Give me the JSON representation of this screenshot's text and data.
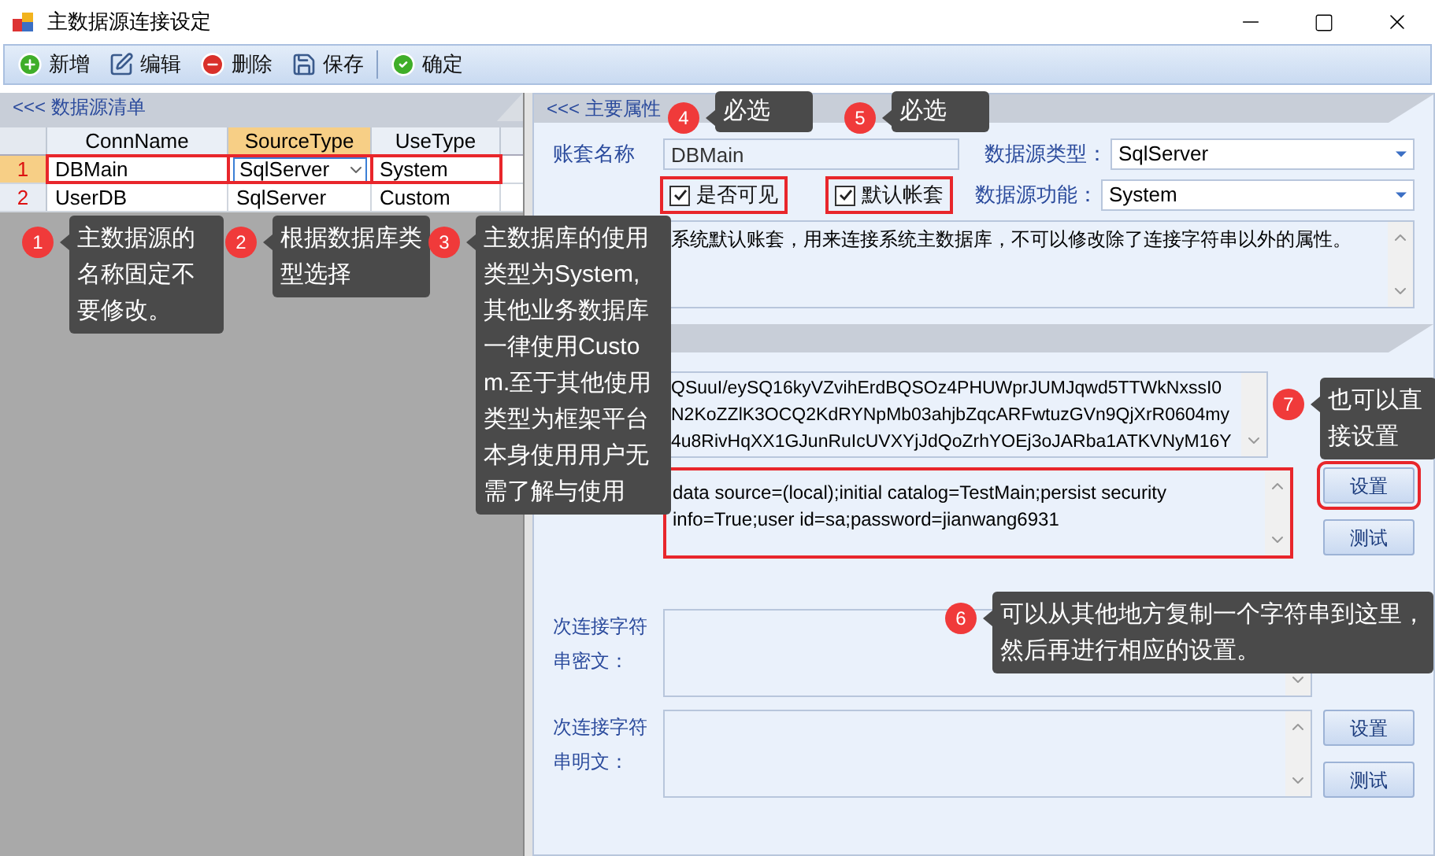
{
  "window": {
    "title": "主数据源连接设定"
  },
  "toolbar": [
    {
      "label": "新增",
      "kind": "add"
    },
    {
      "label": "编辑",
      "kind": "edit"
    },
    {
      "label": "删除",
      "kind": "delete"
    },
    {
      "label": "保存",
      "kind": "save"
    },
    {
      "label": "确定",
      "kind": "confirm"
    }
  ],
  "data_source_list": {
    "title": "<<< 数据源清单",
    "columns": [
      {
        "label": "ConnName",
        "selected": false
      },
      {
        "label": "SourceType",
        "selected": true
      },
      {
        "label": "UseType",
        "selected": false
      }
    ],
    "rows": [
      {
        "number": "1",
        "cells": [
          "DBMain",
          "SqlServer",
          "System"
        ],
        "selected": true
      },
      {
        "number": "2",
        "cells": [
          "UserDB",
          "SqlServer",
          "Custom"
        ],
        "selected": false
      }
    ]
  },
  "main_properties": {
    "title": "<<< 主要属性",
    "account_name": {
      "label": "账套名称",
      "value": "DBMain"
    },
    "visible": {
      "label": "是否可见",
      "checked": true
    },
    "default_account": {
      "label": "默认帐套",
      "checked": true
    },
    "source_type": {
      "label": "数据源类型：",
      "value": "SqlServer"
    },
    "source_function": {
      "label": "数据源功能：",
      "value": "System"
    },
    "remark": {
      "value": "系统默认账套，用来连接系统主数据库，不可以修改除了连接字符串以外的属性。"
    }
  },
  "connection": {
    "primary_cipher": {
      "lines": [
        "QSuuI/eySQ16kyVZvihErdBQSOz4PHUWprJUMJqwd5TTWkNxssI0",
        "N2KoZZlK3OCQ2KdRYNpMb03ahjbZqcARFwtuzGVn9QjXrR0604my",
        "4u8RivHqXX1GJunRuIcUVXYjJdQoZrhYOEj3oJARba1ATKVNyM16Y"
      ]
    },
    "primary_plain": {
      "lines": [
        "data source=(local);initial catalog=TestMain;persist security",
        "info=True;user id=sa;password=jianwang6931"
      ],
      "buttons": [
        "设置",
        "测试"
      ]
    },
    "secondary_cipher": {
      "label": "次连接字符串密文："
    },
    "secondary_plain": {
      "label": "次连接字符串明文：",
      "buttons": [
        "设置",
        "测试"
      ]
    }
  },
  "callouts": [
    {
      "number": "1",
      "text": "主数据源的名称固定不要修改。"
    },
    {
      "number": "2",
      "text": "根据数据库类型选择"
    },
    {
      "number": "3",
      "text": "主数据库的使用类型为System,其他业务数据库一律使用Custom.至于其他使用类型为框架平台本身使用用户无需了解与使用"
    },
    {
      "number": "4",
      "text": "必选"
    },
    {
      "number": "5",
      "text": "必选"
    },
    {
      "number": "7",
      "text": "也可以直接设置"
    },
    {
      "number": "6",
      "text": "可以从其他地方复制一个字符串到这里，然后再进行相应的设置。"
    }
  ]
}
